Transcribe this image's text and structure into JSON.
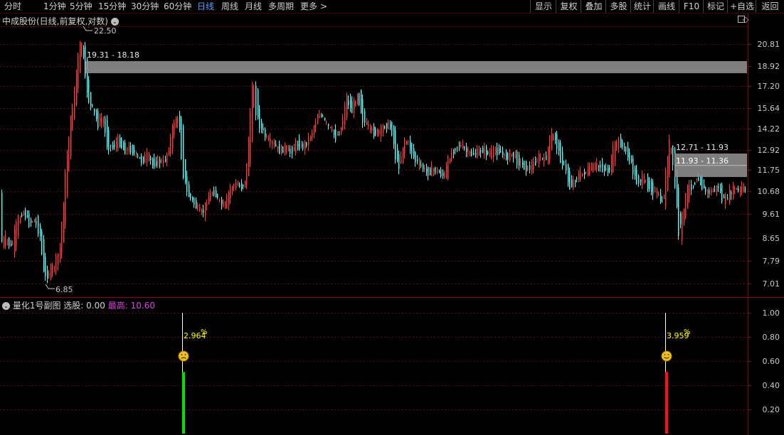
{
  "topbar": {
    "periods": [
      "分时",
      "1分钟",
      "5分钟",
      "15分钟",
      "30分钟",
      "60分钟",
      "日线",
      "周线",
      "月线",
      "多周期",
      "更多"
    ],
    "active_period": "日线",
    "more_arrow": ">",
    "buttons": [
      "显示",
      "复权",
      "叠加",
      "多股",
      "统计",
      "画线",
      "F10",
      "标记",
      "+自选",
      "返回"
    ]
  },
  "main_chart": {
    "title": "中成股份(日线,前复权,对数)",
    "title_toggle": "⌄",
    "y_ticks": [
      "20.81",
      "18.92",
      "17.20",
      "15.64",
      "14.22",
      "12.92",
      "11.75",
      "10.68",
      "9.61",
      "8.65",
      "7.79",
      "7.01"
    ],
    "high_label": "22.50",
    "low_label": "6.85",
    "zones": [
      {
        "label": "19.31 - 18.18"
      },
      {
        "label": "12.71 - 11.93"
      },
      {
        "label": "11.93 - 11.36"
      }
    ],
    "corner_icons": [
      "diamond-icon",
      "square-icon"
    ]
  },
  "indicator": {
    "name": "量化1号副图",
    "field_label": "选股:",
    "field_value": "0.00",
    "high_label": "最高:",
    "high_value": "10.60",
    "y_ticks": [
      "1.00",
      "0.80",
      "0.60",
      "0.40",
      "0.20"
    ],
    "signals": [
      {
        "text": "2.964",
        "pct": "%",
        "face": "sad",
        "bar_color": "green"
      },
      {
        "text": "3.959",
        "pct": "%",
        "face": "happy",
        "bar_color": "red"
      }
    ]
  },
  "colors": {
    "up": "#ff3b3b",
    "down": "#54ffff",
    "zone": "#8c8c8c",
    "grid": "#5a1010",
    "axis_text": "#c8c8c8",
    "signal_text": "#ffff00",
    "face": "#f0c020",
    "highlight": "#e040e0",
    "active_tab": "#5aa0ff"
  }
}
